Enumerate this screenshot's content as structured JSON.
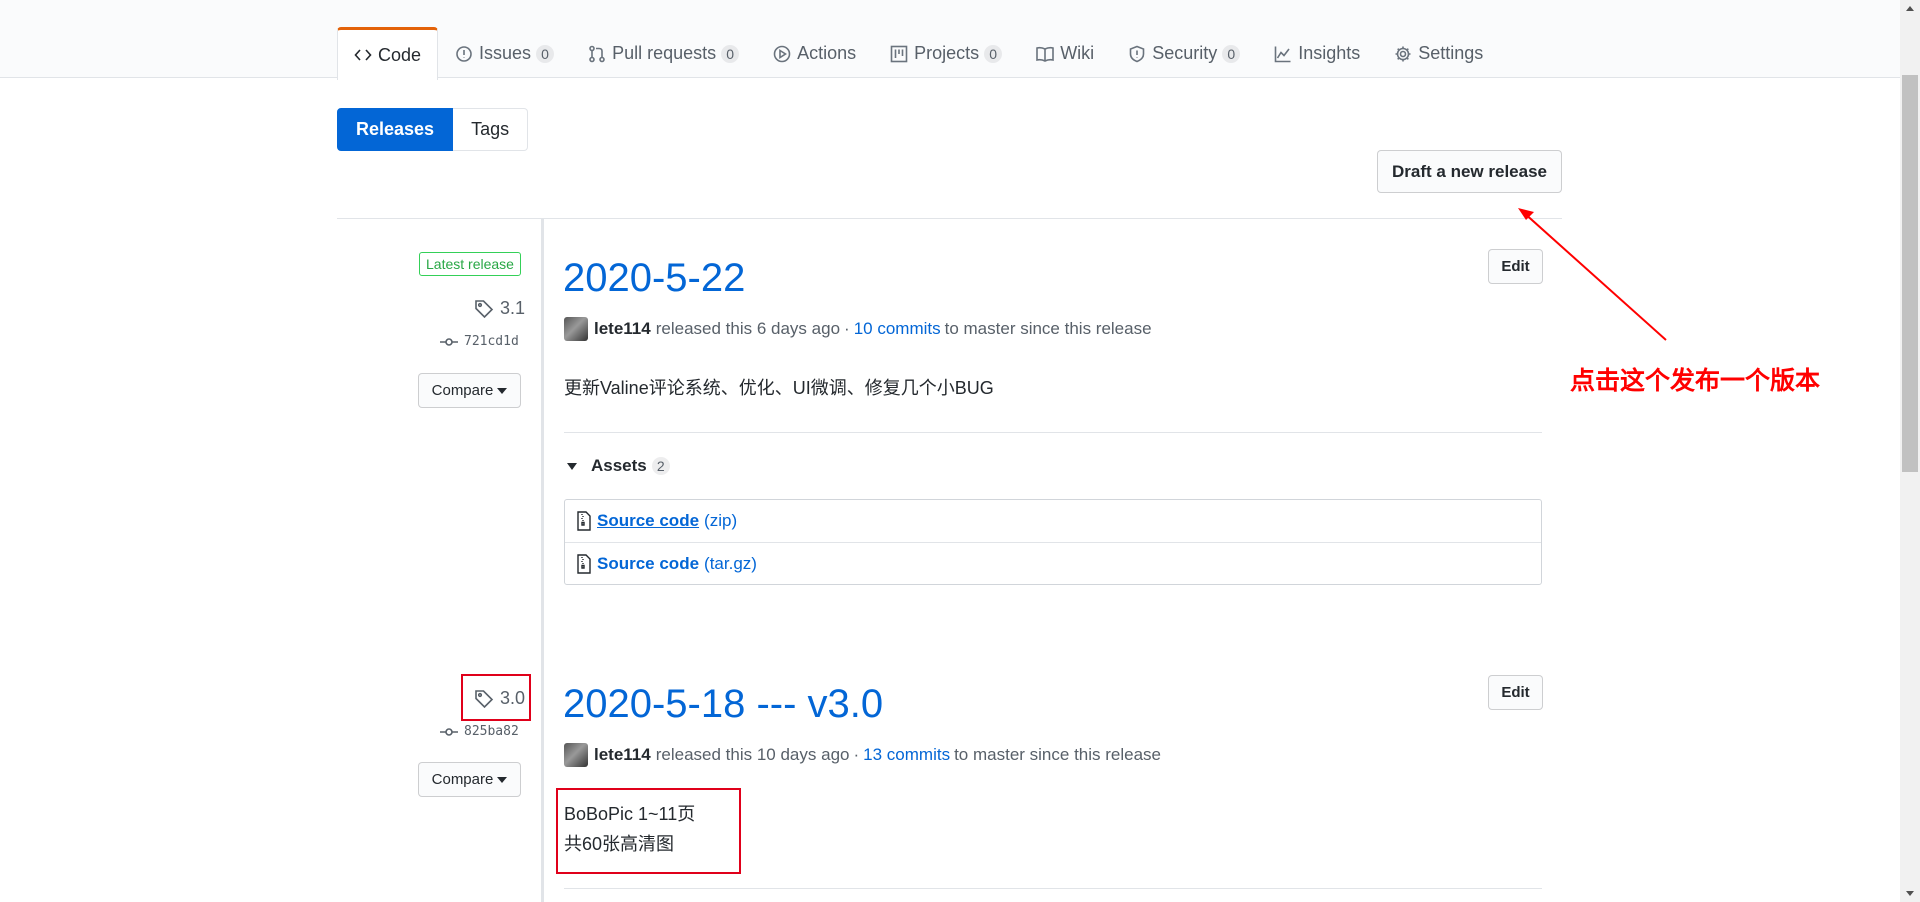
{
  "repo_nav": {
    "tabs": [
      {
        "label": "Code",
        "icon": "code-icon",
        "count": null,
        "selected": true
      },
      {
        "label": "Issues",
        "icon": "issue-icon",
        "count": "0"
      },
      {
        "label": "Pull requests",
        "icon": "pull-request-icon",
        "count": "0"
      },
      {
        "label": "Actions",
        "icon": "play-icon",
        "count": null
      },
      {
        "label": "Projects",
        "icon": "project-icon",
        "count": "0"
      },
      {
        "label": "Wiki",
        "icon": "book-icon",
        "count": null
      },
      {
        "label": "Security",
        "icon": "shield-icon",
        "count": "0"
      },
      {
        "label": "Insights",
        "icon": "graph-icon",
        "count": null
      },
      {
        "label": "Settings",
        "icon": "gear-icon",
        "count": null
      }
    ]
  },
  "subnav": {
    "releases": "Releases",
    "tags": "Tags"
  },
  "draft_button": "Draft a new release",
  "releases": [
    {
      "badge": "Latest release",
      "tag": "3.1",
      "commit": "721cd1d",
      "compare": "Compare",
      "title": "2020-5-22",
      "edit": "Edit",
      "author": "lete114",
      "released_text": "released this 6 days ago",
      "dot": "·",
      "commits_link": "10 commits",
      "since_text": "to master since this release",
      "description": [
        "更新Valine评论系统、优化、UI微调、修复几个小BUG"
      ],
      "assets_label": "Assets",
      "assets_count": "2",
      "assets": [
        {
          "name": "Source code",
          "ext": "(zip)"
        },
        {
          "name": "Source code",
          "ext": "(tar.gz)"
        }
      ]
    },
    {
      "tag": "3.0",
      "commit": "825ba82",
      "compare": "Compare",
      "title": "2020-5-18 --- v3.0",
      "edit": "Edit",
      "author": "lete114",
      "released_text": "released this 10 days ago",
      "dot": "·",
      "commits_link": "13 commits",
      "since_text": "to master since this release",
      "description": [
        "BoBoPic 1~11页",
        "共60张高清图"
      ]
    }
  ],
  "annotation": {
    "text": "点击这个发布一个版本",
    "color": "#ff0000"
  },
  "colors": {
    "accent": "#0366d6",
    "tab_indicator": "#e36209",
    "latest_green": "#28a745"
  }
}
